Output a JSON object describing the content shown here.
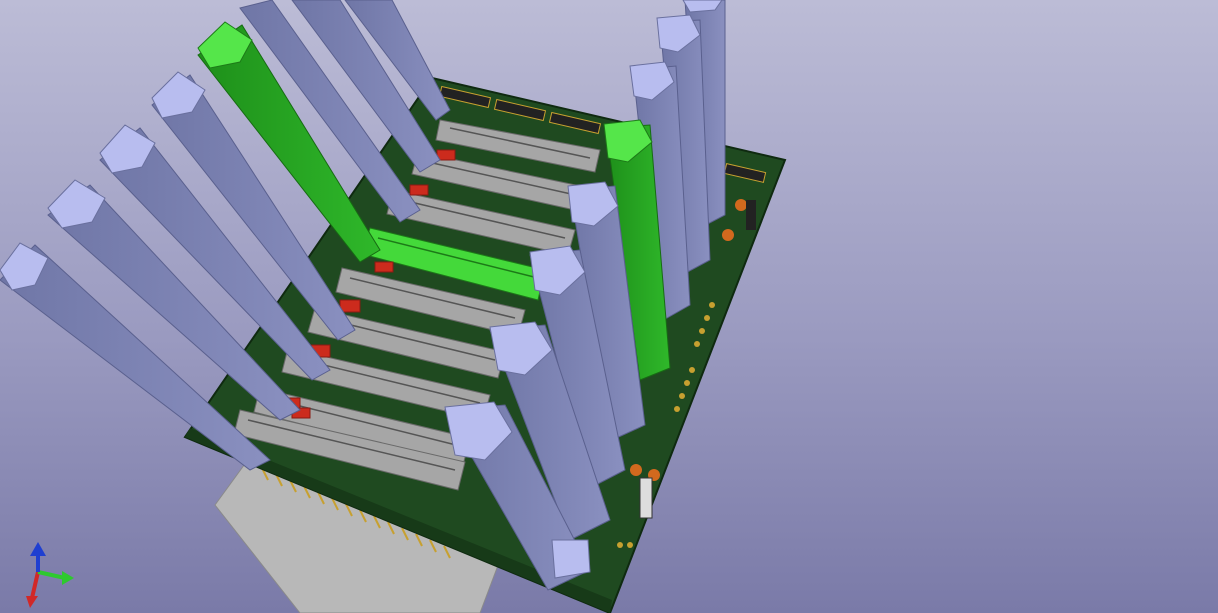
{
  "viewer": {
    "background_top": "#bcbcd6",
    "background_bottom": "#7a7aa8",
    "pcb_color": "#1f4a20",
    "slot_color": "#a0a0a0",
    "guide_color": "#7f86b4",
    "guide_edge_color": "#aab0dd",
    "highlight_color": "#35c42e",
    "connector_red": "#cc2b1d",
    "gold_pin_color": "#c7a030"
  },
  "axis_gizmo": {
    "x_axis_color": "#2ec92e",
    "y_axis_color": "#1f3fd1",
    "z_axis_color": "#d12828"
  }
}
